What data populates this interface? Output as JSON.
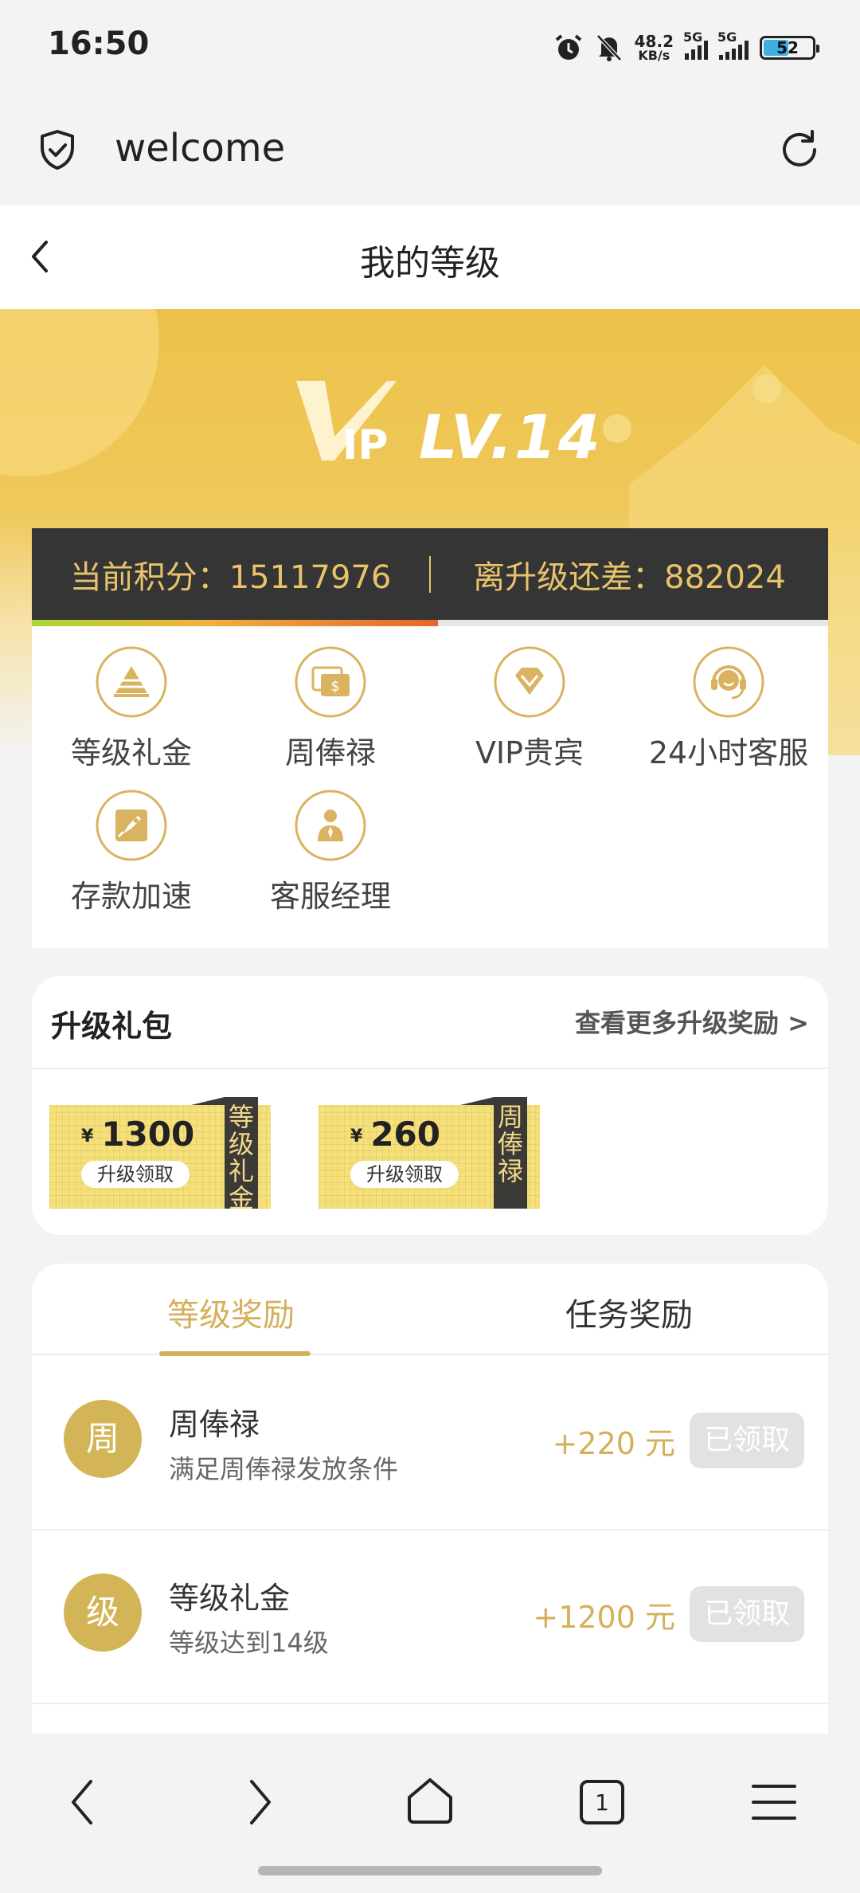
{
  "status_bar": {
    "time": "16:50",
    "net_speed_value": "48.2",
    "net_speed_unit": "KB/s",
    "signal1_label": "5G",
    "signal2_label": "5G",
    "battery": "52",
    "battery_level": 0.52
  },
  "browser": {
    "url": "welcome",
    "icons": [
      "shield-check-icon",
      "reload-icon"
    ]
  },
  "header": {
    "title": "我的等级",
    "back_icon": "chevron-left-icon"
  },
  "banner": {
    "logo_letter": "V",
    "logo_suffix": "IP",
    "level": "LV.14",
    "accent": "#ecc24a"
  },
  "points": {
    "current": "当前积分：15117976",
    "remaining": "离升级还差：882024",
    "progress": 0.51
  },
  "benefits": [
    {
      "label": "等级礼金",
      "icon": "pyramid-icon"
    },
    {
      "label": "周俸禄",
      "icon": "money-card-icon"
    },
    {
      "label": "VIP贵宾",
      "icon": "diamond-icon"
    },
    {
      "label": "24小时客服",
      "icon": "headset-icon"
    },
    {
      "label": "存款加速",
      "icon": "rocket-icon"
    },
    {
      "label": "客服经理",
      "icon": "manager-icon"
    }
  ],
  "packs": {
    "title": "升级礼包",
    "more": "查看更多升级奖励 >",
    "items": [
      {
        "currency": "¥",
        "amount": "1300",
        "claim": "升级领取",
        "tag": "等级礼金"
      },
      {
        "currency": "¥",
        "amount": "260",
        "claim": "升级领取",
        "tag": "周俸禄"
      }
    ]
  },
  "rewards": {
    "tabs": [
      "等级奖励",
      "任务奖励"
    ],
    "active_tab": 0,
    "items": [
      {
        "badge": "周",
        "title": "周俸禄",
        "subtitle": "满足周俸禄发放条件",
        "amount": "+220 元",
        "button": "已领取"
      },
      {
        "badge": "级",
        "title": "等级礼金",
        "subtitle": "等级达到14级",
        "amount": "+1200 元",
        "button": "已领取"
      }
    ]
  },
  "bottom_nav": {
    "tab_count": "1",
    "icons": [
      "back-icon",
      "forward-icon",
      "home-icon",
      "tabs-icon",
      "menu-icon"
    ]
  }
}
